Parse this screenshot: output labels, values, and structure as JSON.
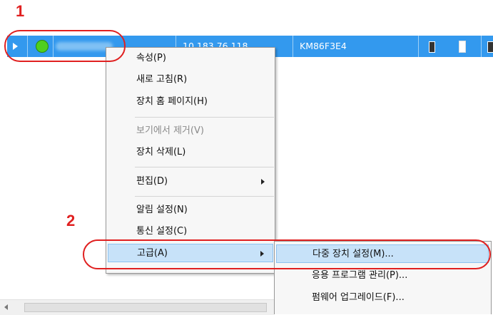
{
  "callouts": {
    "step1": "1",
    "step2": "2"
  },
  "device_row": {
    "ip_address": "10.183.76.118",
    "model": "KM86F3E4",
    "status_color": "#4fcf1f",
    "selected_color": "#3399ee"
  },
  "context_menu": {
    "items": [
      {
        "label": "속성(P)",
        "enabled": true
      },
      {
        "label": "새로 고침(R)",
        "enabled": true
      },
      {
        "label": "장치 홈 페이지(H)",
        "enabled": true
      },
      {
        "label": "보기에서 제거(V)",
        "enabled": false
      },
      {
        "label": "장치 삭제(L)",
        "enabled": true
      },
      {
        "label": "편집(D)",
        "enabled": true,
        "has_submenu": true
      },
      {
        "label": "알림 설정(N)",
        "enabled": true
      },
      {
        "label": "통신 설정(C)",
        "enabled": true
      },
      {
        "label": "고급(A)",
        "enabled": true,
        "has_submenu": true,
        "active": true
      }
    ]
  },
  "submenu": {
    "items": [
      {
        "label": "다중 장치 설정(M)...",
        "active": true
      },
      {
        "label": "응용 프로그램 관리(P)..."
      },
      {
        "label": "펌웨어 업그레이드(F)..."
      }
    ]
  },
  "highlight_color": "#e02020"
}
